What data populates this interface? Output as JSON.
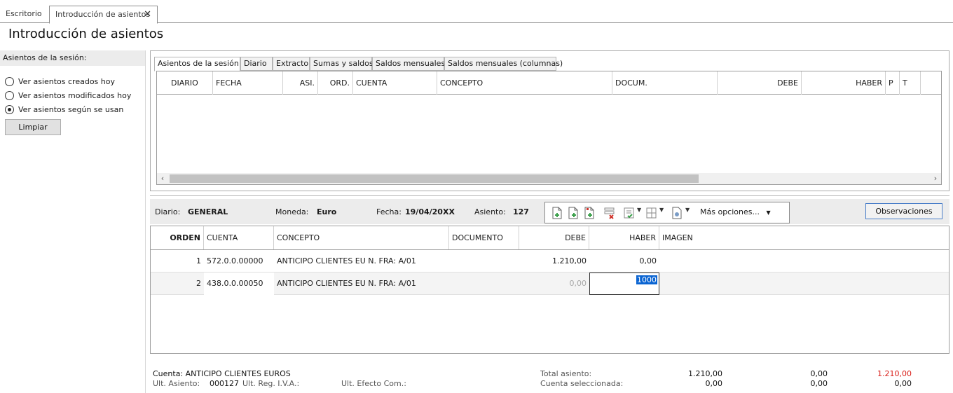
{
  "tabs": {
    "desktop": "Escritorio",
    "active": "Introducción de asientos"
  },
  "title": "Introducción de asientos",
  "left": {
    "header": "Asientos de la sesión:",
    "options": [
      "Ver asientos creados hoy",
      "Ver asientos modificados hoy",
      "Ver asientos según se usan"
    ],
    "selected_index": 2,
    "clear_button": "Limpiar"
  },
  "session_tabs": [
    "Asientos de la sesión",
    "Diario",
    "Extracto",
    "Sumas y saldos",
    "Saldos mensuales",
    "Saldos mensuales (columnas)"
  ],
  "session_columns": [
    "DIARIO",
    "FECHA",
    "ASI.",
    "ORD.",
    "CUENTA",
    "CONCEPTO",
    "DOCUM.",
    "DEBE",
    "HABER",
    "P",
    "T"
  ],
  "info": {
    "diario_label": "Diario:",
    "diario_value": "GENERAL",
    "moneda_label": "Moneda:",
    "moneda_value": "Euro",
    "fecha_label": "Fecha:",
    "fecha_value": "19/04/20XX",
    "asiento_label": "Asiento:",
    "asiento_value": "127",
    "more_options": "Más opciones...",
    "observaciones": "Observaciones"
  },
  "entry_columns": [
    "ORDEN",
    "CUENTA",
    "CONCEPTO",
    "DOCUMENTO",
    "DEBE",
    "HABER",
    "IMAGEN"
  ],
  "entries": [
    {
      "orden": "1",
      "cuenta": "572.0.0.00000",
      "concepto": "ANTICIPO CLIENTES EU N. FRA:  A/01",
      "documento": "",
      "debe": "1.210,00",
      "haber": "0,00"
    },
    {
      "orden": "2",
      "cuenta": "438.0.0.00050",
      "concepto": "ANTICIPO CLIENTES EU N. FRA:  A/01",
      "documento": "",
      "debe": "0,00",
      "haber": "1000"
    }
  ],
  "footer": {
    "cuenta": "Cuenta: ANTICIPO CLIENTES EUROS",
    "ult_asiento_label": "Ult. Asiento:",
    "ult_asiento_value": "000127",
    "ult_reg_iva": "Ult. Reg. I.V.A.:",
    "ult_efecto": "Ult. Efecto Com.:",
    "total_label": "Total asiento:",
    "total_debe": "1.210,00",
    "total_haber": "0,00",
    "total_diff": "1.210,00",
    "sel_label": "Cuenta seleccionada:",
    "sel_debe": "0,00",
    "sel_haber": "0,00",
    "sel_diff": "0,00"
  },
  "colors": {
    "accent": "#0a64d2",
    "diff_red": "#d91e18",
    "icon_green": "#3aa04a",
    "icon_red": "#d0322a"
  }
}
